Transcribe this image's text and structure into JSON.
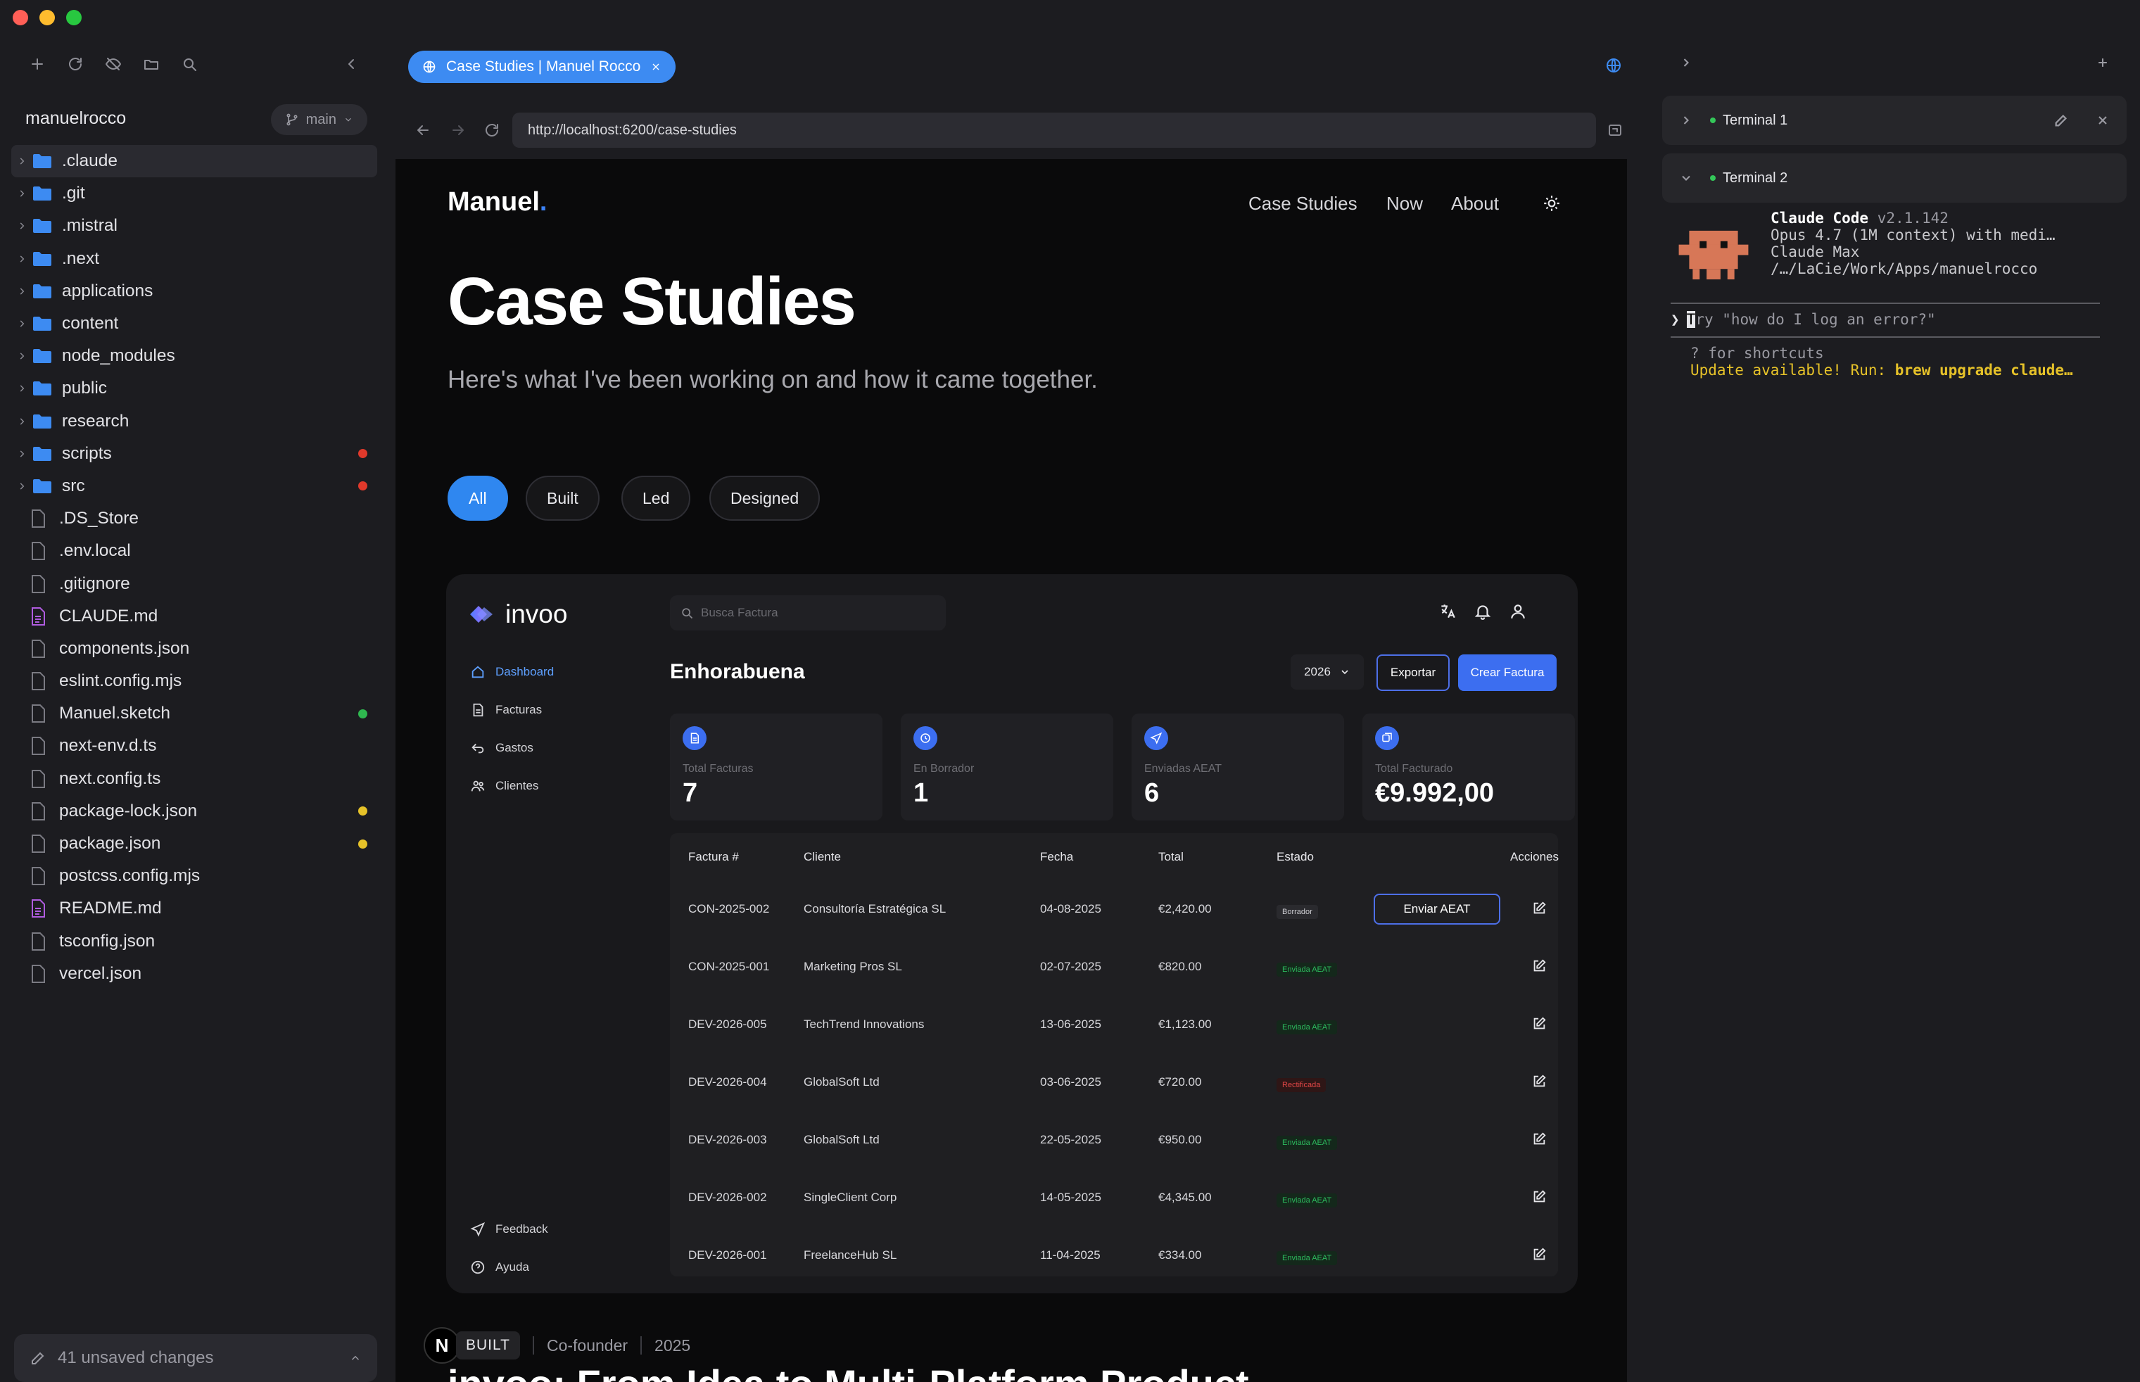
{
  "sidebar": {
    "repo": "manuelrocco",
    "branch": "main",
    "tree": [
      {
        "name": ".claude",
        "type": "folder",
        "selected": true
      },
      {
        "name": ".git",
        "type": "folder"
      },
      {
        "name": ".mistral",
        "type": "folder"
      },
      {
        "name": ".next",
        "type": "folder"
      },
      {
        "name": "applications",
        "type": "folder"
      },
      {
        "name": "content",
        "type": "folder"
      },
      {
        "name": "node_modules",
        "type": "folder"
      },
      {
        "name": "public",
        "type": "folder"
      },
      {
        "name": "research",
        "type": "folder"
      },
      {
        "name": "scripts",
        "type": "folder",
        "status": "red"
      },
      {
        "name": "src",
        "type": "folder",
        "status": "red"
      },
      {
        "name": ".DS_Store",
        "type": "file"
      },
      {
        "name": ".env.local",
        "type": "file"
      },
      {
        "name": ".gitignore",
        "type": "file"
      },
      {
        "name": "CLAUDE.md",
        "type": "md"
      },
      {
        "name": "components.json",
        "type": "file"
      },
      {
        "name": "eslint.config.mjs",
        "type": "file"
      },
      {
        "name": "Manuel.sketch",
        "type": "file",
        "status": "green"
      },
      {
        "name": "next-env.d.ts",
        "type": "file"
      },
      {
        "name": "next.config.ts",
        "type": "file"
      },
      {
        "name": "package-lock.json",
        "type": "file",
        "status": "yellow"
      },
      {
        "name": "package.json",
        "type": "file",
        "status": "yellow"
      },
      {
        "name": "postcss.config.mjs",
        "type": "file"
      },
      {
        "name": "README.md",
        "type": "md"
      },
      {
        "name": "tsconfig.json",
        "type": "file"
      },
      {
        "name": "vercel.json",
        "type": "file"
      }
    ],
    "unsaved": "41 unsaved changes"
  },
  "colors": {
    "accent": "#3d8bf2",
    "status_red": "#e0392b",
    "status_green": "#2fb84f",
    "status_yellow": "#e6c229",
    "folder": "#3d8bf2",
    "md_file": "#b05ce0"
  },
  "browser": {
    "tab_title": "Case Studies | Manuel Rocco",
    "url": "http://localhost:6200/case-studies"
  },
  "site": {
    "logo": "Manuel",
    "logo_dot": ".",
    "nav": [
      "Case Studies",
      "Now",
      "About"
    ],
    "title": "Case Studies",
    "subtitle": "Here's what I've been working on and how it came together.",
    "filters": [
      "All",
      "Built",
      "Led",
      "Designed"
    ],
    "meta_badge": "N",
    "meta_tag": "BUILT",
    "meta_role": "Co-founder",
    "meta_year": "2025",
    "next_title_peek": "invoo: From Idea to Multi-Platform Product"
  },
  "invoo": {
    "logo": "invoo",
    "search_placeholder": "Busca Factura",
    "nav": [
      "Dashboard",
      "Facturas",
      "Gastos",
      "Clientes"
    ],
    "nav_bottom": [
      "Feedback",
      "Ayuda"
    ],
    "greeting": "Enhorabuena",
    "year": "2026",
    "export": "Exportar",
    "create": "Crear Factura",
    "stats": [
      {
        "label": "Total Facturas",
        "value": "7"
      },
      {
        "label": "En Borrador",
        "value": "1"
      },
      {
        "label": "Enviadas AEAT",
        "value": "6"
      },
      {
        "label": "Total Facturado",
        "value": "€9.992,00"
      }
    ],
    "columns": [
      "Factura #",
      "Cliente",
      "Fecha",
      "Total",
      "Estado",
      "Acciones"
    ],
    "rows": [
      {
        "id": "CON-2025-002",
        "client": "Consultoría Estratégica SL",
        "date": "04-08-2025",
        "total": "€2,420.00",
        "status": "Borrador",
        "tone": "gray",
        "action": "Enviar AEAT"
      },
      {
        "id": "CON-2025-001",
        "client": "Marketing Pros SL",
        "date": "02-07-2025",
        "total": "€820.00",
        "status": "Enviada AEAT",
        "tone": "green"
      },
      {
        "id": "DEV-2026-005",
        "client": "TechTrend Innovations",
        "date": "13-06-2025",
        "total": "€1,123.00",
        "status": "Enviada AEAT",
        "tone": "green"
      },
      {
        "id": "DEV-2026-004",
        "client": "GlobalSoft Ltd",
        "date": "03-06-2025",
        "total": "€720.00",
        "status": "Rectificada",
        "tone": "red"
      },
      {
        "id": "DEV-2026-003",
        "client": "GlobalSoft Ltd",
        "date": "22-05-2025",
        "total": "€950.00",
        "status": "Enviada AEAT",
        "tone": "green"
      },
      {
        "id": "DEV-2026-002",
        "client": "SingleClient Corp",
        "date": "14-05-2025",
        "total": "€4,345.00",
        "status": "Enviada AEAT",
        "tone": "green"
      },
      {
        "id": "DEV-2026-001",
        "client": "FreelanceHub SL",
        "date": "11-04-2025",
        "total": "€334.00",
        "status": "Enviada AEAT",
        "tone": "green"
      }
    ]
  },
  "terminal": {
    "tab1": "Terminal 1",
    "tab2": "Terminal 2",
    "app_name": "Claude Code",
    "version": "v2.1.142",
    "model": "Opus 4.7 (1M context) with medi…",
    "plan": "Claude Max",
    "path": "/…/LaCie/Work/Apps/manuelrocco",
    "prompt": "❯",
    "cursor_char": "T",
    "placeholder": "ry \"how do I log an error?\"",
    "shortcuts": "? for shortcuts",
    "update_prefix": "Update available! Run: ",
    "update_cmd": "brew upgrade claude…"
  }
}
